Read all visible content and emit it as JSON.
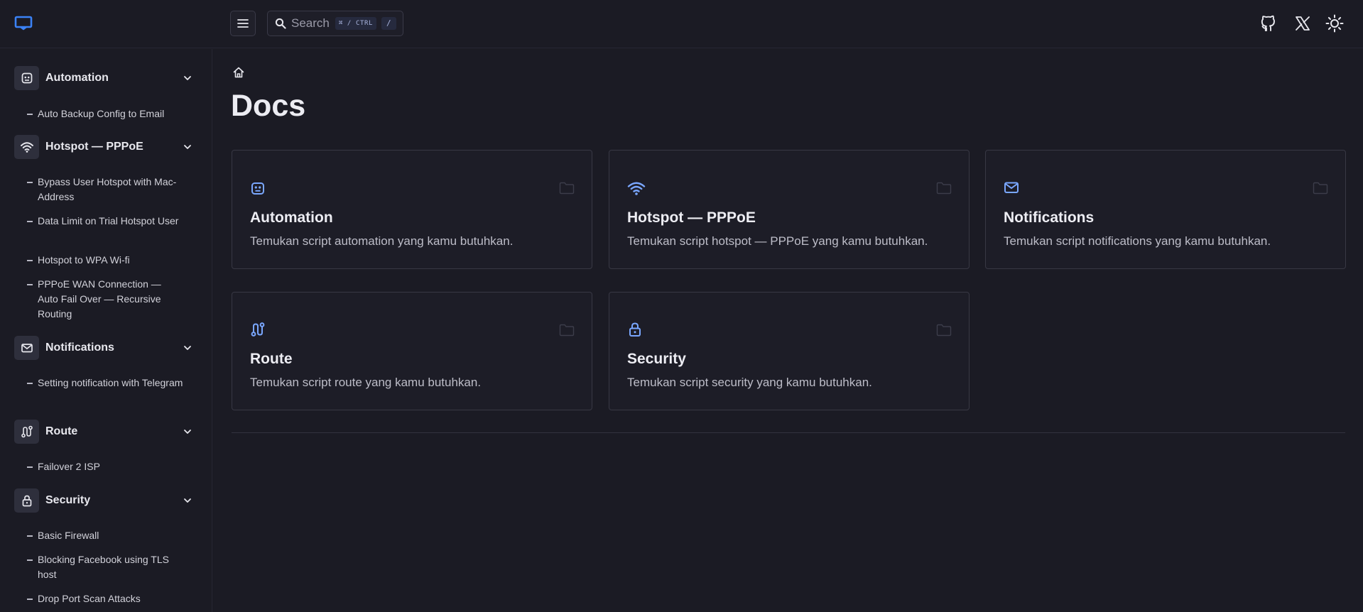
{
  "search": {
    "placeholder": "Search",
    "shortcut": "⌘ / CTRL",
    "shortcut_alt": "/"
  },
  "icons": {
    "logo": "book-open-icon",
    "menu": "hamburger-menu-icon",
    "search": "search-icon",
    "github": "github-icon",
    "x": "x-twitter-icon",
    "theme": "sun-icon",
    "home": "home-icon"
  },
  "colors": {
    "accent": "#3b82f6",
    "icon_blue": "#7aa7ff",
    "background": "#1b1b24"
  },
  "sidebar": {
    "groups": [
      {
        "label": "Automation",
        "icon": "robot-icon",
        "items": [
          "Auto Backup Config to Email"
        ]
      },
      {
        "label": "Hotspot — PPPoE",
        "icon": "wifi-icon",
        "items": [
          "Bypass User Hotspot with Mac-Address",
          "Data Limit on Trial Hotspot User",
          "Hotspot to WPA Wi-fi",
          "PPPoE WAN Connection — Auto Fail Over — Recursive Routing"
        ]
      },
      {
        "label": "Notifications",
        "icon": "mail-icon",
        "items": [
          "Setting notification with Telegram"
        ]
      },
      {
        "label": "Route",
        "icon": "route-icon",
        "items": [
          "Failover 2 ISP"
        ]
      },
      {
        "label": "Security",
        "icon": "lock-icon",
        "items": [
          "Basic Firewall",
          "Blocking Facebook using TLS host",
          "Drop Port Scan Attacks"
        ]
      }
    ]
  },
  "main": {
    "title": "Docs",
    "cards": [
      {
        "title": "Automation",
        "desc": "Temukan script automation yang kamu butuhkan.",
        "icon": "robot-icon"
      },
      {
        "title": "Hotspot — PPPoE",
        "desc": "Temukan script hotspot — PPPoE yang kamu butuhkan.",
        "icon": "wifi-icon"
      },
      {
        "title": "Notifications",
        "desc": "Temukan script notifications yang kamu butuhkan.",
        "icon": "mail-icon"
      },
      {
        "title": "Route",
        "desc": "Temukan script route yang kamu butuhkan.",
        "icon": "route-icon"
      },
      {
        "title": "Security",
        "desc": "Temukan script security yang kamu butuhkan.",
        "icon": "lock-icon"
      }
    ]
  }
}
